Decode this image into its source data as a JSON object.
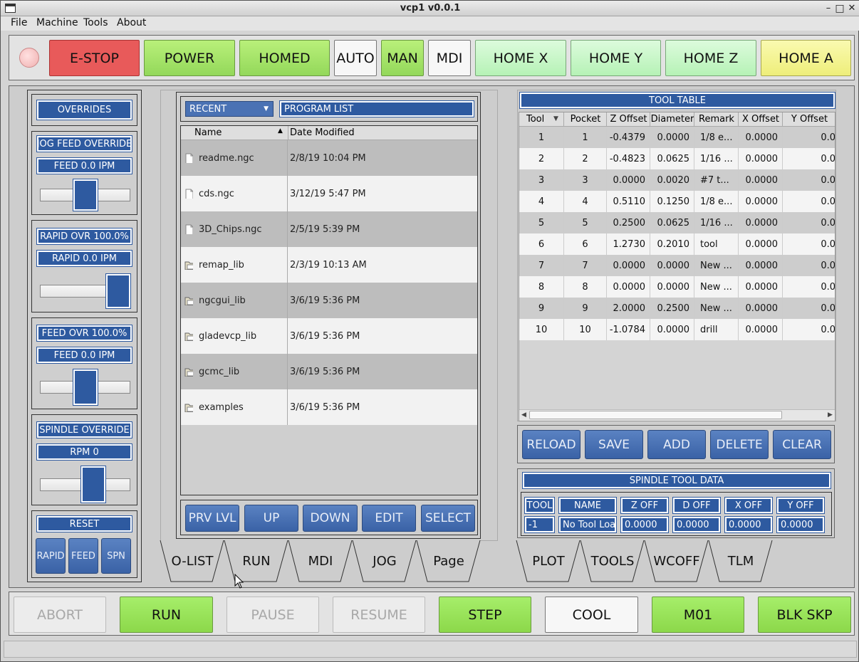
{
  "window": {
    "title": "vcp1 v0.0.1",
    "minimize": "–",
    "maximize": "□",
    "close": "✕"
  },
  "menu": [
    "File",
    "Machine",
    "Tools",
    "About"
  ],
  "top_buttons": {
    "estop": "E-STOP",
    "power": "POWER",
    "homed": "HOMED",
    "auto": "AUTO",
    "man": "MAN",
    "mdi": "MDI",
    "home_x": "HOME X",
    "home_y": "HOME Y",
    "home_z": "HOME Z",
    "home_a": "HOME A"
  },
  "overrides": {
    "title": "OVERRIDES",
    "jog_feed_override": "JOG FEED OVERRIDE",
    "jog_feed": "FEED 0.0  IPM",
    "jog_feed_level": 0.5,
    "rapid_ovr": "RAPID OVR 100.0%",
    "rapid": "RAPID 0.0  IPM",
    "rapid_level": 1.0,
    "feed_ovr": "FEED OVR 100.0%",
    "feed": "FEED 0.0  IPM",
    "feed_level": 0.5,
    "spindle_override": "SPINDLE OVERRIDE",
    "rpm": "RPM 0",
    "spindle_level": 0.62,
    "reset": "RESET",
    "reset_rapid": "RAPID",
    "reset_feed": "FEED",
    "reset_spn": "SPN"
  },
  "file_browser": {
    "filter_value": "RECENT",
    "path_label": "PROGRAM LIST",
    "col_name": "Name",
    "col_date": "Date Modified",
    "files": [
      {
        "name": "readme.ngc",
        "date": "2/8/19 10:04 PM",
        "type": "file"
      },
      {
        "name": "cds.ngc",
        "date": "3/12/19 5:47 PM",
        "type": "file"
      },
      {
        "name": "3D_Chips.ngc",
        "date": "2/5/19 5:39 PM",
        "type": "file"
      },
      {
        "name": "remap_lib",
        "date": "2/3/19 10:13 AM",
        "type": "folder"
      },
      {
        "name": "ngcgui_lib",
        "date": "3/6/19 5:36 PM",
        "type": "folder"
      },
      {
        "name": "gladevcp_lib",
        "date": "3/6/19 5:36 PM",
        "type": "folder"
      },
      {
        "name": "gcmc_lib",
        "date": "3/6/19 5:36 PM",
        "type": "folder"
      },
      {
        "name": "examples",
        "date": "3/6/19 5:36 PM",
        "type": "folder"
      }
    ],
    "buttons": [
      "PRV LVL",
      "UP",
      "DOWN",
      "EDIT",
      "SELECT"
    ]
  },
  "tool_table": {
    "title": "TOOL TABLE",
    "columns": [
      "Tool",
      "Pocket",
      "Z Offset",
      "Diameter",
      "Remark",
      "X Offset",
      "Y Offset"
    ],
    "rows": [
      [
        "1",
        "1",
        "-0.4379",
        "0.0000",
        "1/8 e...",
        "0.0000",
        "0.0"
      ],
      [
        "2",
        "2",
        "-0.4823",
        "0.0625",
        "1/16 ...",
        "0.0000",
        "0.0"
      ],
      [
        "3",
        "3",
        "0.0000",
        "0.0020",
        "#7 t...",
        "0.0000",
        "0.0"
      ],
      [
        "4",
        "4",
        "0.5110",
        "0.1250",
        "1/8 e...",
        "0.0000",
        "0.0"
      ],
      [
        "5",
        "5",
        "0.2500",
        "0.0625",
        "1/16 ...",
        "0.0000",
        "0.0"
      ],
      [
        "6",
        "6",
        "1.2730",
        "0.2010",
        "tool",
        "0.0000",
        "0.0"
      ],
      [
        "7",
        "7",
        "0.0000",
        "0.0000",
        "New ...",
        "0.0000",
        "0.0"
      ],
      [
        "8",
        "8",
        "0.0000",
        "0.0000",
        "New ...",
        "0.0000",
        "0.0"
      ],
      [
        "9",
        "9",
        "2.0000",
        "0.2500",
        "New ...",
        "0.0000",
        "0.0"
      ],
      [
        "10",
        "10",
        "-1.0784",
        "0.0000",
        "drill",
        "0.0000",
        "0.0"
      ]
    ],
    "buttons": [
      "RELOAD",
      "SAVE",
      "ADD",
      "DELETE",
      "CLEAR"
    ]
  },
  "spindle_tool": {
    "title": "SPINDLE TOOL DATA",
    "headers": [
      "TOOL",
      "NAME",
      "Z OFF",
      "D OFF",
      "X OFF",
      "Y OFF"
    ],
    "values": [
      "-1",
      "No Tool Loa",
      "0.0000",
      "0.0000",
      "0.0000",
      "0.0000"
    ]
  },
  "left_tabs": [
    "O-LIST",
    "RUN",
    "MDI",
    "JOG",
    "Page"
  ],
  "right_tabs": [
    "PLOT",
    "TOOLS",
    "WCOFF",
    "TLM"
  ],
  "bottom_buttons": {
    "abort": "ABORT",
    "run": "RUN",
    "pause": "PAUSE",
    "resume": "RESUME",
    "step": "STEP",
    "cool": "COOL",
    "m01": "M01",
    "blk_skp": "BLK SKP"
  }
}
